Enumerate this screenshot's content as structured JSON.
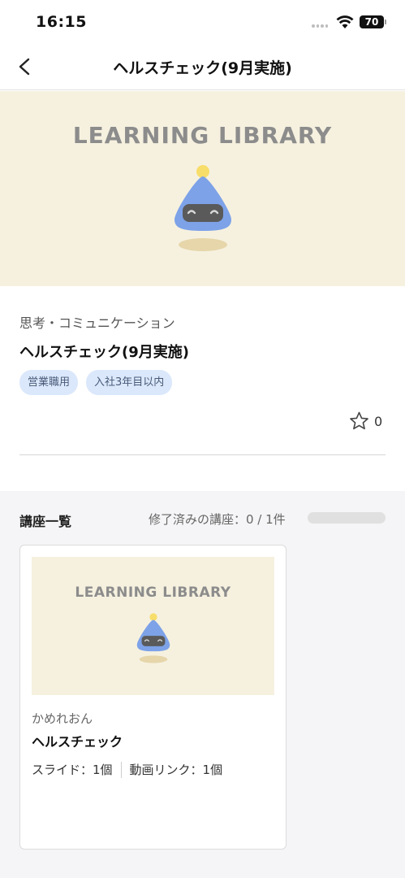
{
  "status_bar": {
    "time": "16:15",
    "battery": "70"
  },
  "nav": {
    "title": "ヘルスチェック(9月実施)"
  },
  "hero": {
    "brand_text": "LEARNING LIBRARY"
  },
  "detail": {
    "category": "思考・コミュニケーション",
    "title": "ヘルスチェック(9月実施)",
    "tags": [
      "営業職用",
      "入社3年目以内"
    ],
    "favorite_count": "0"
  },
  "course_list": {
    "heading": "講座一覧",
    "progress_text": "修了済みの講座：0 / 1件",
    "progress_fraction": 0,
    "courses": [
      {
        "thumb_text": "LEARNING LIBRARY",
        "author": "かめれおん",
        "title": "ヘルスチェック",
        "slides": "スライド：1個",
        "video_links": "動画リンク：1個"
      }
    ]
  },
  "colors": {
    "hero_bg": "#f6f1df",
    "tag_bg": "#dbe8fb",
    "mascot_blue": "#7da2e8",
    "mascot_yellow": "#f7dd6a",
    "list_bg": "#f5f5f7"
  },
  "icons": [
    "back-chevron-icon",
    "wifi-icon",
    "star-outline-icon",
    "mascot-illustration"
  ]
}
